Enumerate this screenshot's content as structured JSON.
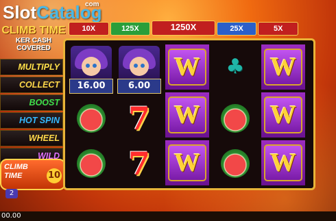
{
  "watermark": {
    "part1": "Slot",
    "part2": "Catalog",
    "domain": "com"
  },
  "game_title": {
    "line1": "CLIMB TIME",
    "line2": "KER CASH",
    "line3": "COVERED"
  },
  "features": [
    {
      "label": "MULTIPLY",
      "color": "#ffe04a"
    },
    {
      "label": "COLLECT",
      "color": "#ffd84a"
    },
    {
      "label": "BOOST",
      "color": "#3fe04a"
    },
    {
      "label": "HOT SPIN",
      "color": "#35b9ff"
    },
    {
      "label": "WHEEL",
      "color": "#ffd84a"
    },
    {
      "label": "WILD",
      "color": "#e070ff"
    }
  ],
  "climb_time": {
    "label_line1": "CLIMB",
    "label_line2": "TIME",
    "count": "10"
  },
  "badge": "2",
  "balance": "00.00",
  "multipliers": [
    {
      "label": "10X",
      "color": "#c11f1f"
    },
    {
      "label": "125X",
      "color": "#2a9e3a"
    },
    {
      "label": "1250X",
      "color": "#c11f1f"
    },
    {
      "label": "25X",
      "color": "#2b5fc9"
    },
    {
      "label": "5X",
      "color": "#c11f1f"
    }
  ],
  "reels": [
    {
      "symbols": [
        "jester-face",
        "watermelon",
        "watermelon"
      ],
      "value": "16.00"
    },
    {
      "symbols": [
        "jester-face",
        "seven",
        "seven"
      ],
      "value": "6.00"
    },
    {
      "symbols": [
        "wild",
        "wild",
        "wild"
      ]
    },
    {
      "symbols": [
        "club",
        "watermelon",
        "watermelon"
      ]
    },
    {
      "symbols": [
        "wild",
        "wild",
        "wild"
      ]
    }
  ],
  "wild_letter": "W",
  "seven_glyph": "7",
  "club_glyph": "♣"
}
